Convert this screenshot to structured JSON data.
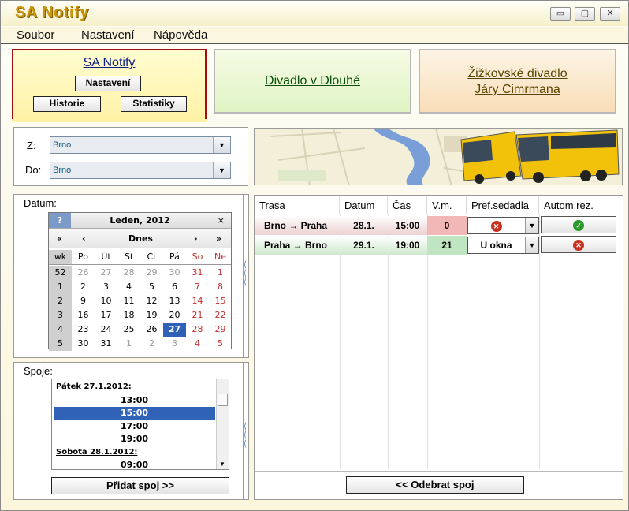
{
  "window": {
    "title": "SA Notify",
    "controls": {
      "minimize": "▭",
      "maximize": "▢",
      "close": "✕"
    }
  },
  "menu": [
    "Soubor",
    "Nastavení",
    "Nápověda"
  ],
  "cards": {
    "main": {
      "title": "SA Notify",
      "settings_button": "Nastavení",
      "history_button": "Historie",
      "stats_button": "Statistiky"
    },
    "theatre1": {
      "title": "Divadlo v Dlouhé"
    },
    "theatre2": {
      "line1": "Žižkovské divadlo ",
      "line2": "Járy Cimrmana"
    }
  },
  "route": {
    "from_label": "Z:",
    "from_value": "Brno",
    "to_label": "Do:",
    "to_value": "Brno"
  },
  "calendar": {
    "section_label": "Datum:",
    "help": "?",
    "month": "Leden, 2012",
    "close": "×",
    "nav": {
      "prev_year": "«",
      "prev_month": "‹",
      "today": "Dnes",
      "next_month": "›",
      "next_year": "»"
    },
    "weekday_headers": [
      "wk",
      "Po",
      "Út",
      "St",
      "Čt",
      "Pá",
      "So",
      "Ne"
    ],
    "weeks": [
      {
        "wk": "52",
        "days": [
          "26",
          "27",
          "28",
          "29",
          "30",
          "31",
          "1"
        ]
      },
      {
        "wk": "1",
        "days": [
          "2",
          "3",
          "4",
          "5",
          "6",
          "7",
          "8"
        ]
      },
      {
        "wk": "2",
        "days": [
          "9",
          "10",
          "11",
          "12",
          "13",
          "14",
          "15"
        ]
      },
      {
        "wk": "3",
        "days": [
          "16",
          "17",
          "18",
          "19",
          "20",
          "21",
          "22"
        ]
      },
      {
        "wk": "4",
        "days": [
          "23",
          "24",
          "25",
          "26",
          "27",
          "28",
          "29"
        ]
      },
      {
        "wk": "5",
        "days": [
          "30",
          "31",
          "1",
          "2",
          "3",
          "4",
          "5"
        ]
      }
    ],
    "selected_day": "27"
  },
  "connections": {
    "section_label": "Spoje:",
    "items": [
      {
        "type": "header",
        "text": "Pátek 27.1.2012:"
      },
      {
        "type": "time",
        "text": "13:00"
      },
      {
        "type": "time",
        "text": "15:00",
        "selected": true
      },
      {
        "type": "time",
        "text": "17:00"
      },
      {
        "type": "time",
        "text": "19:00"
      },
      {
        "type": "header",
        "text": "Sobota 28.1.2012:"
      },
      {
        "type": "time",
        "text": "09:00"
      }
    ],
    "add_button": "Přidat spoj >>"
  },
  "table": {
    "headers": [
      "Trasa",
      "Datum",
      "Čas",
      "V.m.",
      "Pref.sedadla",
      "Autom.rez."
    ],
    "rows": [
      {
        "route": "Brno → Praha",
        "date": "28.1.",
        "time": "15:00",
        "seats": "0",
        "pref": "",
        "pref_icon": "x-circle-icon",
        "auto_icon": "check-circle-icon"
      },
      {
        "route": "Praha → Brno",
        "date": "29.1.",
        "time": "19:00",
        "seats": "21",
        "pref": "U okna",
        "pref_icon": "",
        "auto_icon": "x-circle-icon"
      }
    ],
    "remove_button": "<< Odebrat spoj"
  },
  "colors": {
    "title": "#c8960a",
    "card_border_active": "#a01010",
    "link_blue": "#0b1d8a",
    "link_green": "#0a4e0a",
    "selection": "#2f62b6",
    "seats_empty": "#f2b8b8",
    "seats_available": "#bfe5c3"
  }
}
